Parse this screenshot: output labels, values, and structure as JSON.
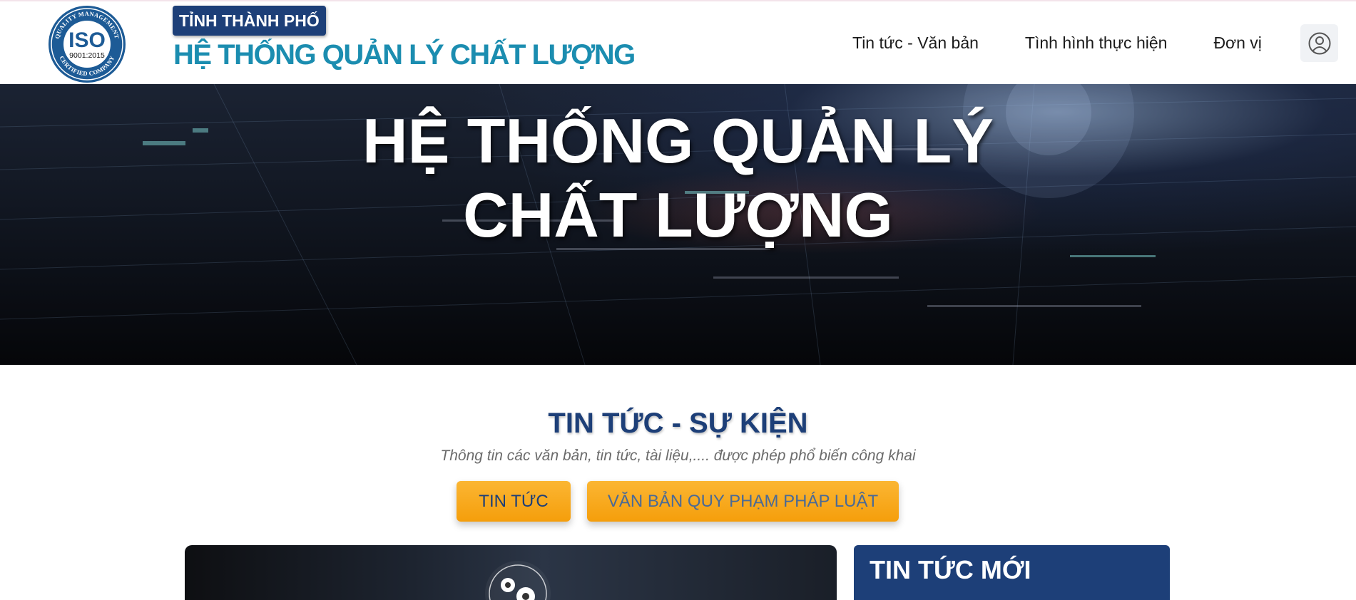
{
  "header": {
    "logo": {
      "icon": "iso-certification-logo",
      "main": "ISO",
      "standard": "9001:2015",
      "ring_top": "QUALITY MANAGEMENT",
      "ring_bottom": "CERTIFIED COMPANY"
    },
    "brand_tag": "TỈNH THÀNH PHỐ",
    "brand_title": "HỆ THỐNG QUẢN LÝ CHẤT LƯỢNG",
    "nav": [
      "Tin tức - Văn bản",
      "Tình hình thực hiện",
      "Đơn vị"
    ],
    "user_icon": "user-circle-icon"
  },
  "hero": {
    "title_line1": "HỆ THỐNG QUẢN LÝ",
    "title_line2": "CHẤT LƯỢNG"
  },
  "news": {
    "title": "TIN TỨC - SỰ KIỆN",
    "subtitle": "Thông tin các văn bản, tin tức, tài liệu,.... được phép phổ biến công khai",
    "tabs": [
      {
        "label": "TIN TỨC",
        "active": true
      },
      {
        "label": "VĂN BẢN QUY PHẠM PHÁP LUẬT",
        "active": false
      }
    ],
    "feature_icon": "gears-icon",
    "side_title": "TIN TỨC MỚI"
  },
  "colors": {
    "primary_navy": "#1d3f78",
    "brand_teal": "#1b8db0",
    "accent_orange": "#f59e0b"
  }
}
